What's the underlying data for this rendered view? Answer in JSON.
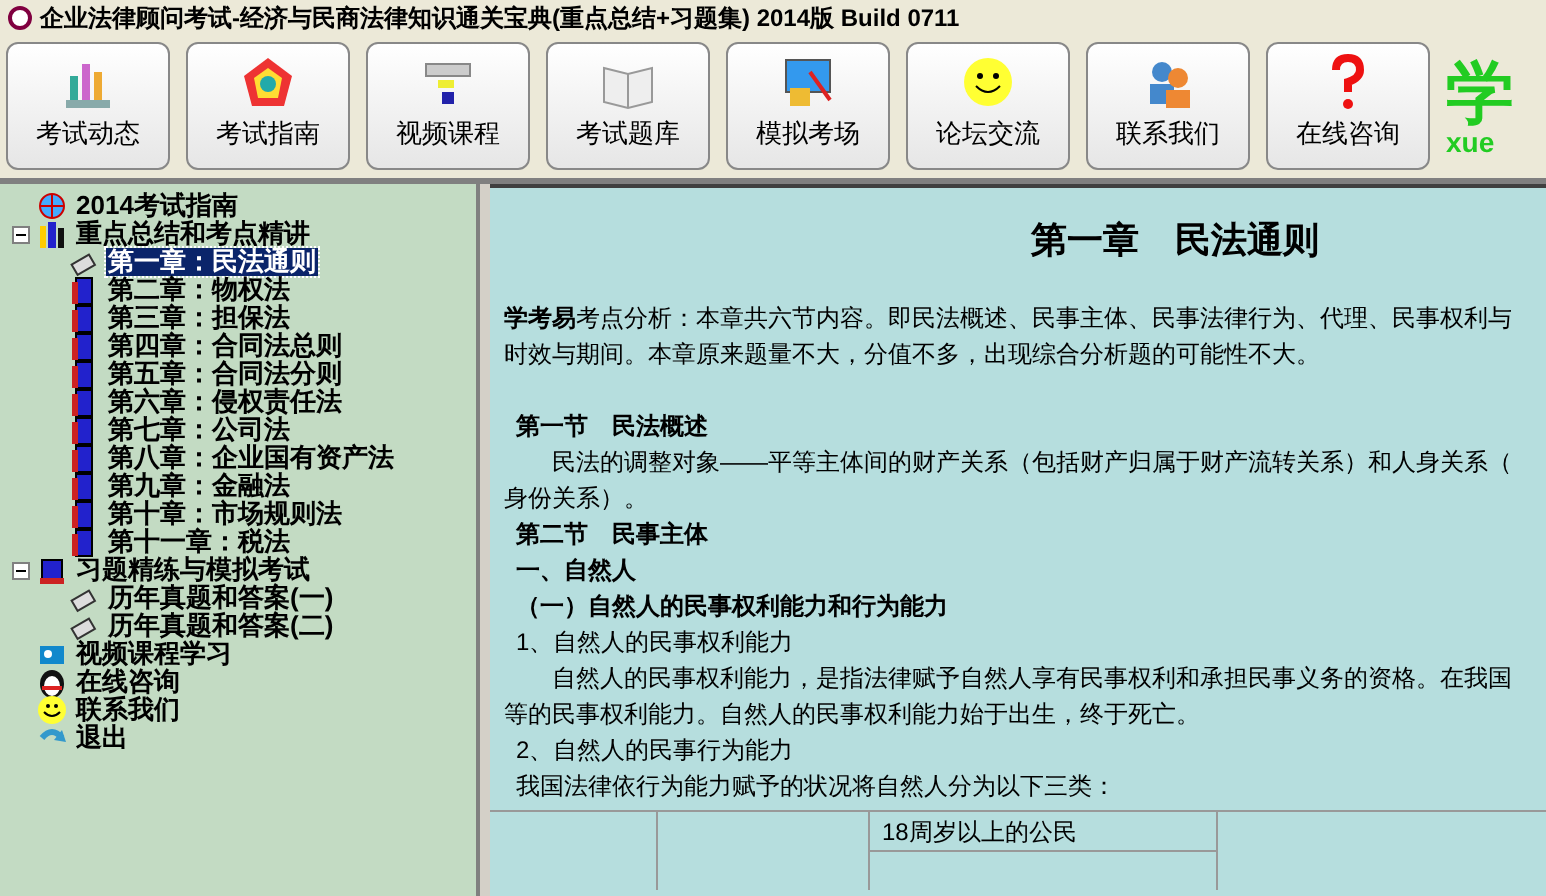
{
  "window": {
    "title": "企业法律顾问考试-经济与民商法律知识通关宝典(重点总结+习题集) 2014版 Build 0711"
  },
  "toolbar": [
    {
      "label": "考试动态"
    },
    {
      "label": "考试指南"
    },
    {
      "label": "视频课程"
    },
    {
      "label": "考试题库"
    },
    {
      "label": "模拟考场"
    },
    {
      "label": "论坛交流"
    },
    {
      "label": "联系我们"
    },
    {
      "label": "在线咨询"
    }
  ],
  "logo": {
    "text": "学",
    "subtext": "xue"
  },
  "tree": [
    {
      "label": "2014考试指南",
      "selected": false
    },
    {
      "label": "重点总结和考点精讲",
      "selected": false,
      "expanded": true,
      "children": [
        {
          "label": "第一章：民法通则",
          "selected": true
        },
        {
          "label": "第二章：物权法",
          "selected": false
        },
        {
          "label": "第三章：担保法",
          "selected": false
        },
        {
          "label": "第四章：合同法总则",
          "selected": false
        },
        {
          "label": "第五章：合同法分则",
          "selected": false
        },
        {
          "label": "第六章：侵权责任法",
          "selected": false
        },
        {
          "label": "第七章：公司法",
          "selected": false
        },
        {
          "label": "第八章：企业国有资产法",
          "selected": false
        },
        {
          "label": "第九章：金融法",
          "selected": false
        },
        {
          "label": "第十章：市场规则法",
          "selected": false
        },
        {
          "label": "第十一章：税法",
          "selected": false
        }
      ]
    },
    {
      "label": "习题精练与模拟考试",
      "selected": false,
      "expanded": true,
      "children": [
        {
          "label": "历年真题和答案(一)",
          "selected": false
        },
        {
          "label": "历年真题和答案(二)",
          "selected": false
        }
      ]
    },
    {
      "label": "视频课程学习",
      "selected": false
    },
    {
      "label": "在线咨询",
      "selected": false
    },
    {
      "label": "联系我们",
      "selected": false
    },
    {
      "label": "退出",
      "selected": false
    }
  ],
  "document": {
    "title": "第一章　民法通则",
    "blocks": [
      {
        "kind": "para",
        "lines": [
          "**学考易**考点分析：本章共六节内容。即民法概述、民事主体、民事法律行为、代理、民事权利与",
          "时效与期间。本章原来题量不大，分值不多，出现综合分析题的可能性不大。"
        ]
      },
      {
        "kind": "heading",
        "text": "第一节　民法概述"
      },
      {
        "kind": "para",
        "indent": true,
        "lines": [
          "民法的调整对象——平等主体间的财产关系（包括财产归属于财产流转关系）和人身关系（",
          "身份关系）。"
        ]
      },
      {
        "kind": "heading",
        "text": "第二节　民事主体"
      },
      {
        "kind": "heading",
        "text": "一、自然人"
      },
      {
        "kind": "heading",
        "text": "（一）自然人的民事权利能力和行为能力"
      },
      {
        "kind": "line",
        "text": "1、自然人的民事权利能力"
      },
      {
        "kind": "para",
        "indent": true,
        "lines": [
          "自然人的民事权利能力，是指法律赋予自然人享有民事权利和承担民事义务的资格。在我国",
          "等的民事权利能力。自然人的民事权利能力始于出生，终于死亡。"
        ]
      },
      {
        "kind": "line",
        "text": "2、自然人的民事行为能力"
      },
      {
        "kind": "line",
        "text": "我国法律依行为能力赋予的状况将自然人分为以下三类："
      }
    ],
    "table": {
      "cell": "18周岁以上的公民"
    }
  }
}
